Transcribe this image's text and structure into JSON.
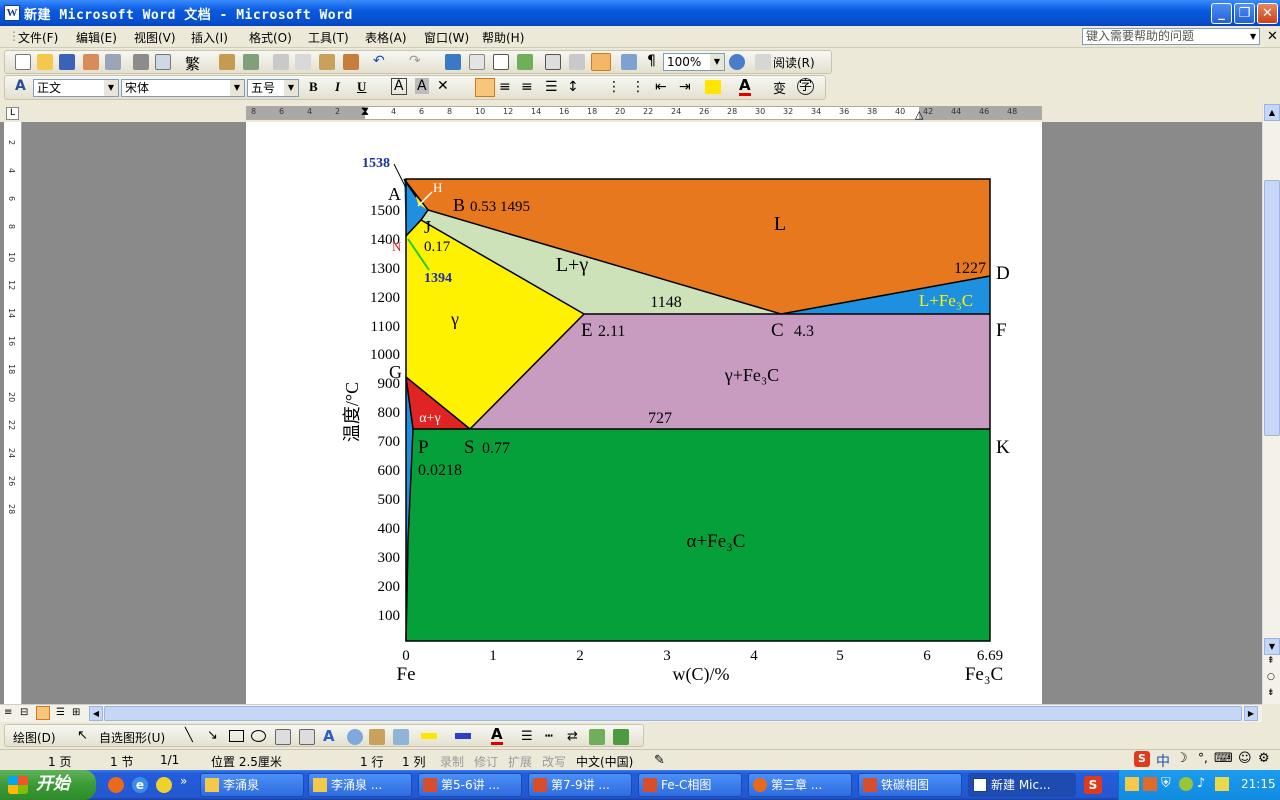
{
  "window": {
    "title": "新建 Microsoft Word 文档 - Microsoft Word"
  },
  "menu": {
    "items": [
      "文件(F)",
      "编辑(E)",
      "视图(V)",
      "插入(I)",
      "格式(O)",
      "工具(T)",
      "表格(A)",
      "窗口(W)",
      "帮助(H)"
    ],
    "help_placeholder": "键入需要帮助的问题"
  },
  "toolbar": {
    "zoom": "100%",
    "read_label": "阅读(R)",
    "trad_label": "繁"
  },
  "format_bar": {
    "style": "正文",
    "font": "宋体",
    "size": "五号",
    "bold": "B",
    "italic": "I",
    "underline": "U"
  },
  "ruler": {
    "ticks": [
      "8",
      "6",
      "4",
      "2",
      "2",
      "4",
      "6",
      "8",
      "10",
      "12",
      "14",
      "16",
      "18",
      "20",
      "22",
      "24",
      "26",
      "28",
      "30",
      "32",
      "34",
      "36",
      "38",
      "40",
      "42",
      "44",
      "46",
      "48"
    ]
  },
  "vruler": {
    "ticks": [
      "2",
      "4",
      "6",
      "8",
      "10",
      "12",
      "14",
      "16",
      "18",
      "20",
      "22",
      "24",
      "26",
      "28"
    ]
  },
  "diagram": {
    "y_axis_label": "温度/°C",
    "y_ticks": [
      "1500",
      "1400",
      "1300",
      "1200",
      "1100",
      "1000",
      "900",
      "800",
      "700",
      "600",
      "500",
      "400",
      "300",
      "200",
      "100"
    ],
    "x_ticks": [
      "0",
      "1",
      "2",
      "3",
      "4",
      "5",
      "6",
      "6.69"
    ],
    "x_axis_label": "w(C)/%",
    "x_left": "Fe",
    "x_right": "Fe₃C",
    "labels": {
      "t1538": "1538",
      "A": "A",
      "H": "H",
      "B": "B",
      "b_val": "0.53 1495",
      "J": "J",
      "j_val": "0.17",
      "N": "N",
      "t1394": "1394",
      "L": "L",
      "Lgamma": "L+γ",
      "t1148": "1148",
      "t1227": "1227",
      "D": "D",
      "LFe3C": "L+Fe₃C",
      "gamma": "γ",
      "E": "E",
      "e_val": "2.11",
      "C": "C",
      "c_val": "4.3",
      "F": "F",
      "G": "G",
      "gammaFe3C": "γ+Fe₃C",
      "alphaGamma": "α+γ",
      "t727": "727",
      "P": "P",
      "S": "S",
      "s_val": "0.77",
      "p_val": "0.0218",
      "K": "K",
      "alphaFe3C": "α+Fe₃C"
    },
    "colors": {
      "L": "#E8781E",
      "Lgamma": "#CDE2B8",
      "gamma": "#FFF200",
      "gammaFe3C": "#C89BC0",
      "alphaFe3C": "#05A03A",
      "alphaGamma": "#E02424",
      "LFe3C": "#1E90E0",
      "delta": "#1E90E0"
    }
  },
  "status": {
    "page": "1 页",
    "section": "1 节",
    "pages": "1/1",
    "position": "位置 2.5厘米",
    "line": "1 行",
    "col": "1 列",
    "rec": "录制",
    "trk": "修订",
    "ext": "扩展",
    "ovr": "改写",
    "lang": "中文(中国)"
  },
  "drawing": {
    "draw": "绘图(D)",
    "autoshape": "自选图形(U)"
  },
  "taskbar": {
    "start": "开始",
    "tasks": [
      "李涌泉",
      "李涌泉 ...",
      "第5-6讲 ...",
      "第7-9讲 ...",
      "Fe-C相图",
      "第三章 ...",
      "铁碳相图",
      "新建 Mic..."
    ],
    "clock": "21:15",
    "ime": "中"
  }
}
